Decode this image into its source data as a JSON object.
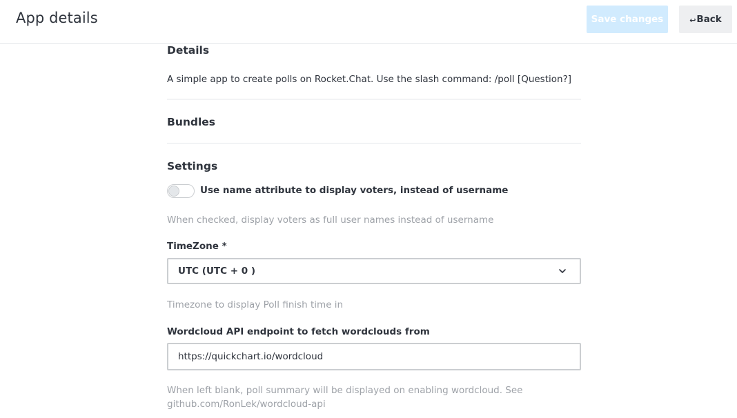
{
  "header": {
    "title": "App details",
    "save_label": "Save changes",
    "back_label": "Back",
    "back_icon": "↩"
  },
  "details": {
    "title": "Details",
    "description": "A simple app to create polls on Rocket.Chat. Use the slash command: /poll [Question?]"
  },
  "bundles": {
    "title": "Bundles"
  },
  "settings": {
    "title": "Settings",
    "toggle": {
      "label": "Use name attribute to display voters, instead of username",
      "checked": false,
      "hint": "When checked, display voters as full user names instead of username"
    },
    "timezone": {
      "label": "TimeZone *",
      "value": "UTC (UTC + 0 )",
      "hint": "Timezone to display Poll finish time in"
    },
    "wordcloud": {
      "label": "Wordcloud API endpoint to fetch wordclouds from",
      "value": "https://quickchart.io/wordcloud",
      "hint": "When left blank, poll summary will be displayed on enabling wordcloud. See github.com/RonLek/wordcloud-api"
    }
  },
  "colors": {
    "primary_disabled": "#d1ebfe",
    "text": "#2f343d",
    "hint": "#9ea2a8",
    "border": "#cbced1"
  }
}
